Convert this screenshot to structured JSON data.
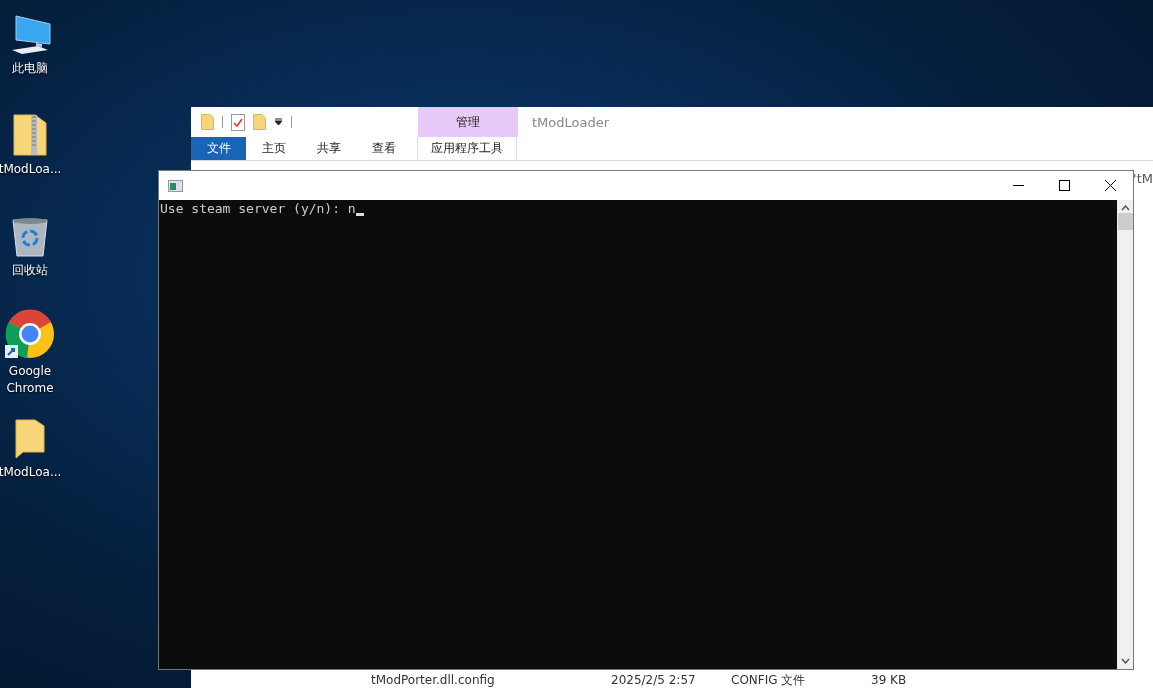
{
  "desktop_icons": [
    {
      "kind": "computer",
      "label": "此电脑"
    },
    {
      "kind": "zip",
      "label": "tModLoa..."
    },
    {
      "kind": "recycle",
      "label": "回收站"
    },
    {
      "kind": "chrome",
      "label": "Google Chrome"
    },
    {
      "kind": "folder",
      "label": "tModLoa..."
    }
  ],
  "explorer": {
    "title": "tModLoader",
    "context_tab": "管理",
    "tabs": [
      {
        "label": "文件",
        "selected": true
      },
      {
        "label": "主页",
        "selected": false
      },
      {
        "label": "共享",
        "selected": false
      },
      {
        "label": "查看",
        "selected": false
      },
      {
        "label": "应用程序工具",
        "selected": false
      }
    ],
    "address_fragment": "'tM",
    "file_row": {
      "name": "tModPorter.dll.config",
      "date": "2025/2/5 2:57",
      "type": "CONFIG 文件",
      "size": "39 KB"
    }
  },
  "console": {
    "text": "Use steam server (y/n): n"
  }
}
